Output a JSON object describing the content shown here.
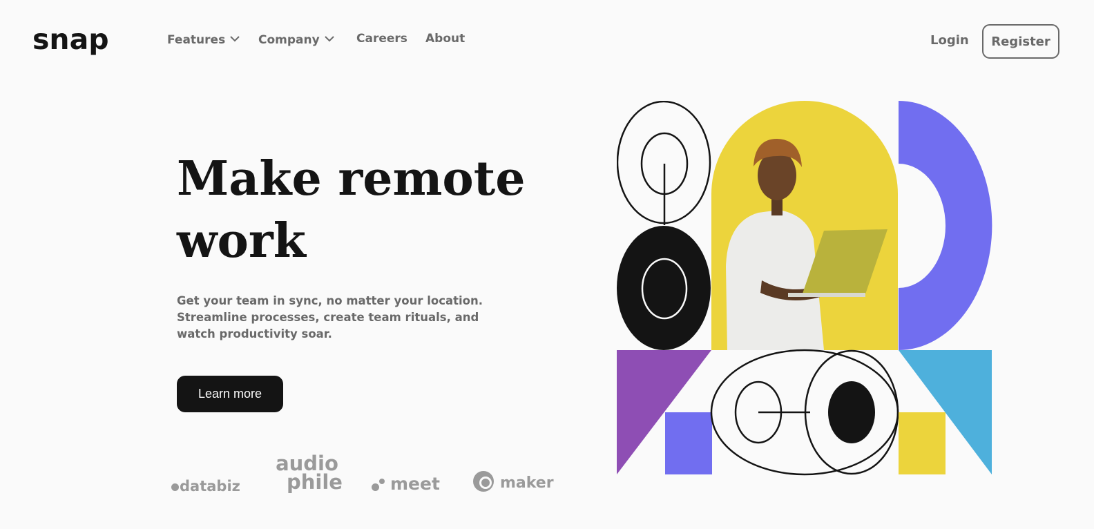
{
  "brand": {
    "logo": "snap"
  },
  "nav": {
    "items": [
      {
        "label": "Features",
        "dropdown": true
      },
      {
        "label": "Company",
        "dropdown": true
      },
      {
        "label": "Careers",
        "dropdown": false
      },
      {
        "label": "About",
        "dropdown": false
      }
    ],
    "login_label": "Login",
    "register_label": "Register"
  },
  "hero": {
    "headline_line1": "Make remote",
    "headline_line2": "work",
    "subtext": "Get your team in sync, no matter your location. Streamline processes, create team rituals, and watch productivity soar.",
    "cta_label": "Learn more"
  },
  "clients": [
    {
      "name": "databiz"
    },
    {
      "name_line1": "audio",
      "name_line2": "phile"
    },
    {
      "name": "meet"
    },
    {
      "name": "maker"
    }
  ],
  "colors": {
    "text_dark": "#141414",
    "text_gray": "#696969",
    "background": "#fafafa",
    "yellow": "#ecd43c",
    "blue_violet": "#716ef0",
    "purple": "#8e4eb4",
    "sky_blue": "#4eb0dc"
  },
  "icons": [
    "chevron-down-icon",
    "chevron-down-icon"
  ]
}
